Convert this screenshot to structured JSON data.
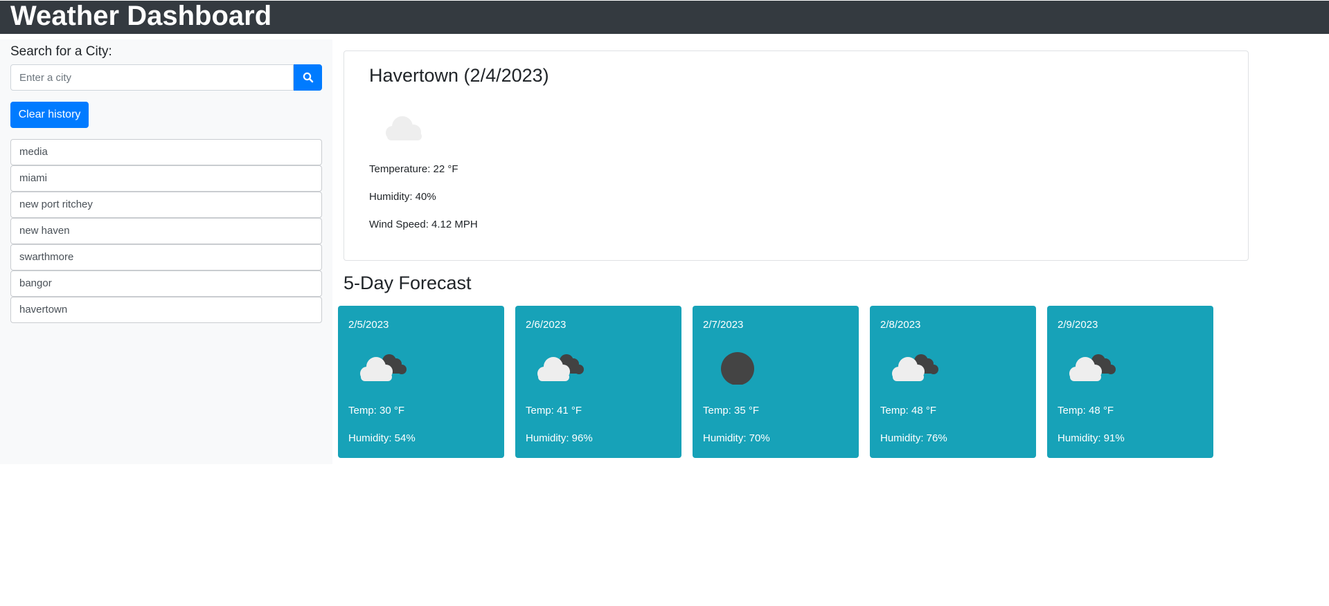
{
  "header": {
    "title": "Weather Dashboard"
  },
  "sidebar": {
    "search_label": "Search for a City:",
    "search_placeholder": "Enter a city",
    "search_value": "",
    "search_icon": "search-icon",
    "clear_label": "Clear history",
    "history": [
      {
        "label": "media"
      },
      {
        "label": "miami"
      },
      {
        "label": "new port ritchey"
      },
      {
        "label": "new haven"
      },
      {
        "label": "swarthmore"
      },
      {
        "label": "bangor"
      },
      {
        "label": "havertown"
      }
    ]
  },
  "current": {
    "title": "Havertown (2/4/2023)",
    "icon": "cloud-icon",
    "temperature": "Temperature: 22 °F",
    "humidity": "Humidity: 40%",
    "wind": "Wind Speed: 4.12 MPH"
  },
  "forecast": {
    "heading": "5-Day Forecast",
    "days": [
      {
        "date": "2/5/2023",
        "icon": "broken-clouds-icon",
        "temp": "Temp: 30 °F",
        "humidity": "Humidity: 54%"
      },
      {
        "date": "2/6/2023",
        "icon": "broken-clouds-icon",
        "temp": "Temp: 41 °F",
        "humidity": "Humidity: 96%"
      },
      {
        "date": "2/7/2023",
        "icon": "overcast-icon",
        "temp": "Temp: 35 °F",
        "humidity": "Humidity: 70%"
      },
      {
        "date": "2/8/2023",
        "icon": "broken-clouds-icon",
        "temp": "Temp: 48 °F",
        "humidity": "Humidity: 76%"
      },
      {
        "date": "2/9/2023",
        "icon": "broken-clouds-icon",
        "temp": "Temp: 48 °F",
        "humidity": "Humidity: 91%"
      }
    ]
  },
  "colors": {
    "header_bg": "#343a40",
    "primary": "#007bff",
    "forecast_card": "#17a2b8",
    "sidebar_bg": "#f8f9fa"
  }
}
